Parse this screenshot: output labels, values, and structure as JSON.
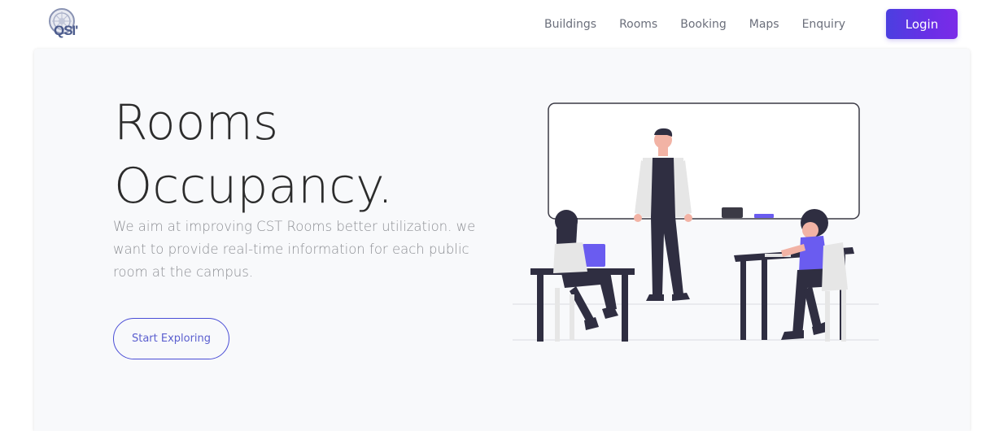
{
  "brand": {
    "logo_text": "QSI'"
  },
  "nav": {
    "links": [
      "Buildings",
      "Rooms",
      "Booking",
      "Maps",
      "Enquiry"
    ],
    "login_label": "Login"
  },
  "hero": {
    "title_line1": "Rooms",
    "title_line2": "Occupancy.",
    "description": "We aim at improving CST Rooms better utilization. we want to provide real-time information for each public room at the campus.",
    "cta_label": "Start Exploring"
  },
  "colors": {
    "accent": "#4b3fe0",
    "accent_end": "#7b2be8",
    "hero_bg": "#f8f9fb",
    "title": "#2c2c2c",
    "description": "#8d8f94",
    "nav_link": "#6b6f7b"
  },
  "icons": {
    "logo": "emblem-icon",
    "illustration": "classroom-illustration"
  }
}
